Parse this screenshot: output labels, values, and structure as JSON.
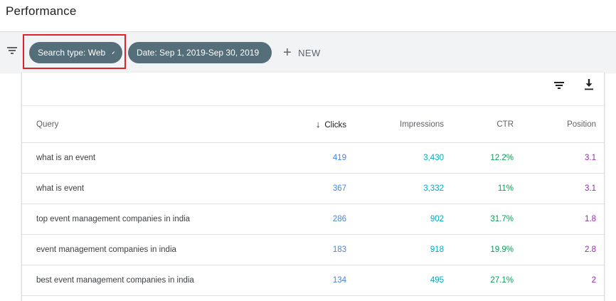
{
  "header": {
    "title": "Performance"
  },
  "filters": {
    "chips": [
      {
        "label": "Search type: Web"
      },
      {
        "label": "Date: Sep 1, 2019-Sep 30, 2019"
      }
    ],
    "new_label": "NEW",
    "plus": "+",
    "chip_color": "#546e7a",
    "highlight_color": "#e0202b"
  },
  "table": {
    "sort_arrow": "↓",
    "columns": [
      "Query",
      "Clicks",
      "Impressions",
      "CTR",
      "Position"
    ],
    "rows": [
      {
        "query": "what is an event",
        "clicks": "419",
        "impressions": "3,430",
        "ctr": "12.2%",
        "position": "3.1"
      },
      {
        "query": "what is event",
        "clicks": "367",
        "impressions": "3,332",
        "ctr": "11%",
        "position": "3.1"
      },
      {
        "query": "top event management companies in india",
        "clicks": "286",
        "impressions": "902",
        "ctr": "31.7%",
        "position": "1.8"
      },
      {
        "query": "event management companies in india",
        "clicks": "183",
        "impressions": "918",
        "ctr": "19.9%",
        "position": "2.8"
      },
      {
        "query": "best event management companies in india",
        "clicks": "134",
        "impressions": "495",
        "ctr": "27.1%",
        "position": "2"
      }
    ]
  },
  "colors": {
    "clicks": "#4285f4",
    "impressions": "#00acc1",
    "ctr": "#0f9d58",
    "position": "#9c27b0"
  },
  "icons": [
    "filter-icon",
    "pencil-icon",
    "plus-icon",
    "download-icon",
    "arrow-down-icon"
  ]
}
